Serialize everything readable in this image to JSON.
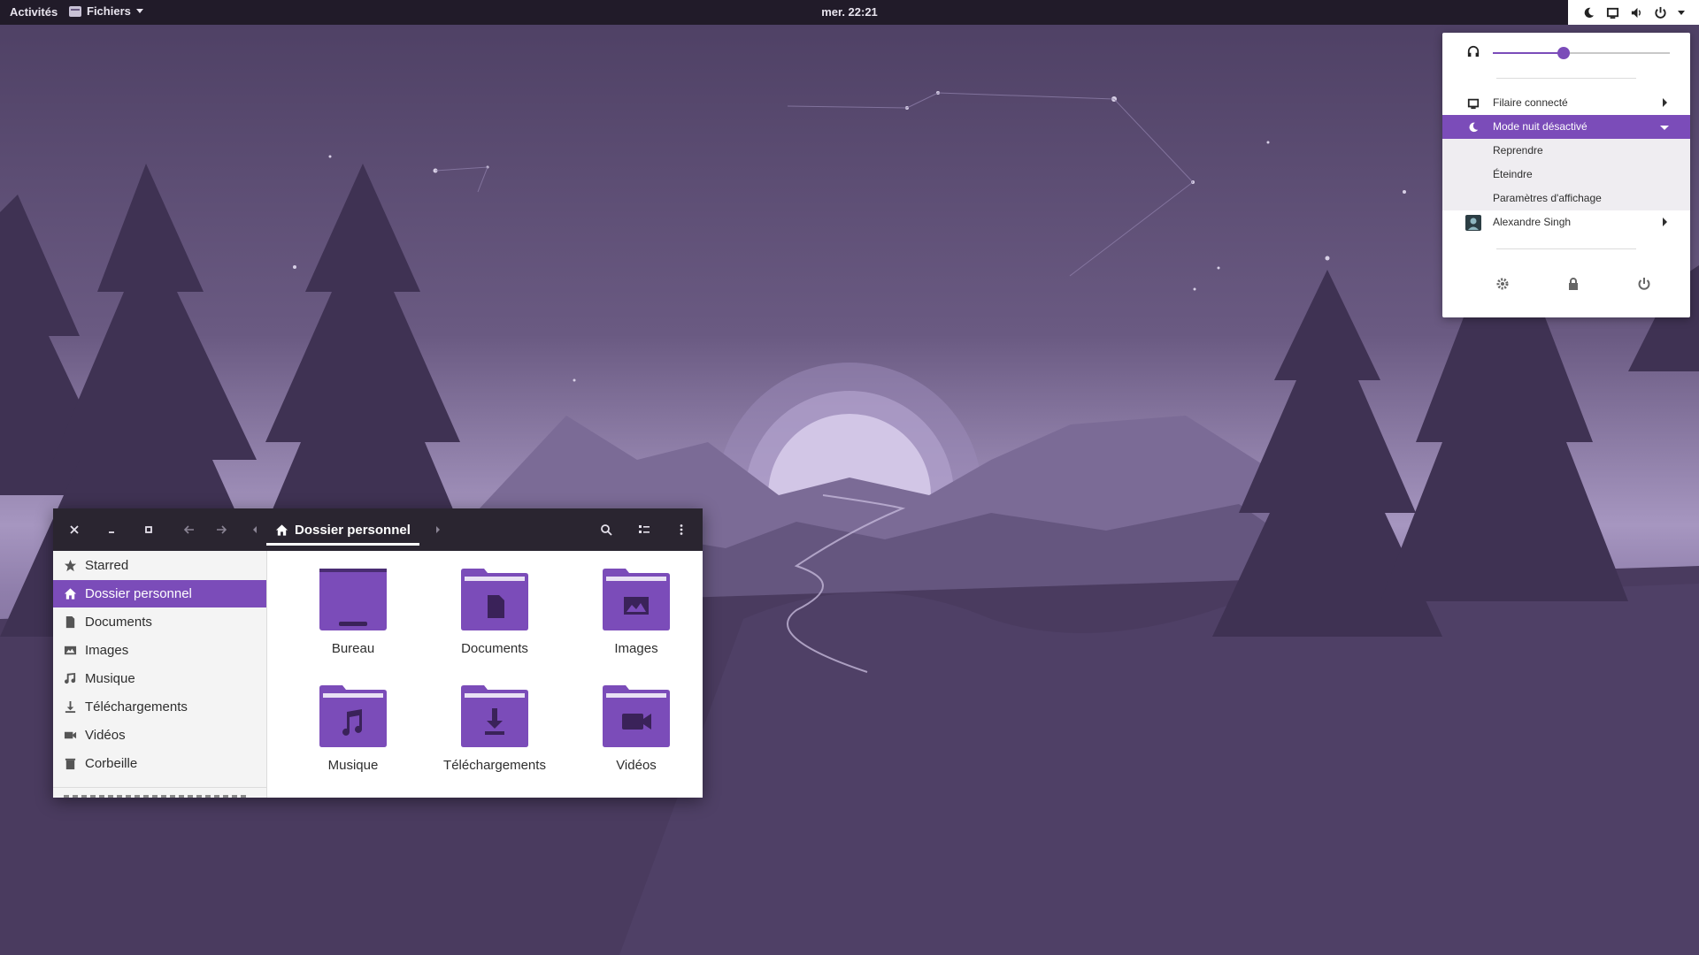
{
  "topbar": {
    "activities": "Activités",
    "app_name": "Fichiers",
    "clock": "mer. 22:21"
  },
  "system_menu": {
    "volume_level": 0.4,
    "wired": "Filaire connecté",
    "night_mode": "Mode nuit désactivé",
    "night_submenu": [
      "Reprendre",
      "Éteindre",
      "Paramètres d'affichage"
    ],
    "user": "Alexandre Singh"
  },
  "files": {
    "breadcrumb": "Dossier personnel",
    "sidebar": [
      "Starred",
      "Dossier personnel",
      "Documents",
      "Images",
      "Musique",
      "Téléchargements",
      "Vidéos",
      "Corbeille"
    ],
    "items": [
      "Bureau",
      "Documents",
      "Images",
      "Musique",
      "Téléchargements",
      "Vidéos"
    ]
  },
  "colors": {
    "accent": "#7b4cb9",
    "topbar": "#211b29",
    "wallpaper": "#4a3b5f"
  }
}
